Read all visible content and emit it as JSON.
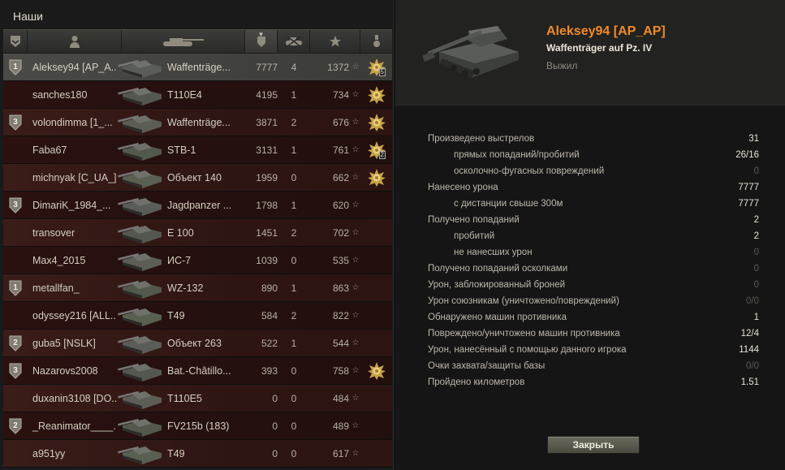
{
  "team_title": "Наши",
  "icons": {
    "header": [
      "rank-icon",
      "player-icon",
      "vehicle-icon",
      "damage-icon",
      "kills-icon",
      "xp-icon",
      "medal-icon"
    ]
  },
  "players": [
    {
      "badge": "1",
      "name": "Aleksey94 [AP_A...",
      "vehicle": "Waffenträge...",
      "damage": "7777",
      "kills": "4",
      "xp": "1372",
      "medal": "ace",
      "medal_count": "5",
      "selected": true
    },
    {
      "badge": "",
      "name": "sanches180",
      "vehicle": "T110E4",
      "damage": "4195",
      "kills": "1",
      "xp": "734",
      "medal": "ace",
      "medal_count": ""
    },
    {
      "badge": "3",
      "name": "volondimma [1_...",
      "vehicle": "Waffenträge...",
      "damage": "3871",
      "kills": "2",
      "xp": "676",
      "medal": "ace",
      "medal_count": ""
    },
    {
      "badge": "",
      "name": "Faba67",
      "vehicle": "STB-1",
      "damage": "3131",
      "kills": "1",
      "xp": "761",
      "medal": "ace",
      "medal_count": "2"
    },
    {
      "badge": "",
      "name": "michnyak [C_UA_]",
      "vehicle": "Объект 140",
      "damage": "1959",
      "kills": "0",
      "xp": "662",
      "medal": "ace",
      "medal_count": ""
    },
    {
      "badge": "3",
      "name": "DimariK_1984_...",
      "vehicle": "Jagdpanzer ...",
      "damage": "1798",
      "kills": "1",
      "xp": "620",
      "medal": "",
      "medal_count": ""
    },
    {
      "badge": "",
      "name": "transover",
      "vehicle": "E 100",
      "damage": "1451",
      "kills": "2",
      "xp": "702",
      "medal": "",
      "medal_count": ""
    },
    {
      "badge": "",
      "name": "Max4_2015",
      "vehicle": "ИС-7",
      "damage": "1039",
      "kills": "0",
      "xp": "535",
      "medal": "",
      "medal_count": ""
    },
    {
      "badge": "1",
      "name": "metallfan_",
      "vehicle": "WZ-132",
      "damage": "890",
      "kills": "1",
      "xp": "863",
      "medal": "",
      "medal_count": ""
    },
    {
      "badge": "",
      "name": "odyssey216 [ALL...",
      "vehicle": "T49",
      "damage": "584",
      "kills": "2",
      "xp": "822",
      "medal": "",
      "medal_count": ""
    },
    {
      "badge": "2",
      "name": "guba5 [NSLK]",
      "vehicle": "Объект 263",
      "damage": "522",
      "kills": "1",
      "xp": "544",
      "medal": "",
      "medal_count": ""
    },
    {
      "badge": "3",
      "name": "Nazarovs2008",
      "vehicle": "Bat.-Châtillo...",
      "damage": "393",
      "kills": "0",
      "xp": "758",
      "medal": "ace",
      "medal_count": ""
    },
    {
      "badge": "",
      "name": "duxanin3108 [DO...",
      "vehicle": "T110E5",
      "damage": "0",
      "kills": "0",
      "xp": "484",
      "medal": "",
      "medal_count": ""
    },
    {
      "badge": "2",
      "name": "_Reanimator____...",
      "vehicle": "FV215b (183)",
      "damage": "0",
      "kills": "0",
      "xp": "489",
      "medal": "",
      "medal_count": ""
    },
    {
      "badge": "",
      "name": "a951yy",
      "vehicle": "T49",
      "damage": "0",
      "kills": "0",
      "xp": "617",
      "medal": "",
      "medal_count": ""
    }
  ],
  "detail": {
    "player": "Aleksey94 [AP_AP]",
    "vehicle": "Waffenträger auf Pz. IV",
    "status": "Выжил",
    "stats": [
      {
        "label": "Произведено выстрелов",
        "value": "31",
        "indent": false,
        "zero": false
      },
      {
        "label": "прямых попаданий/пробитий",
        "value": "26/16",
        "indent": true,
        "zero": false
      },
      {
        "label": "осколочно-фугасных повреждений",
        "value": "0",
        "indent": true,
        "zero": true
      },
      {
        "label": "Нанесено урона",
        "value": "7777",
        "indent": false,
        "zero": false
      },
      {
        "label": "с дистанции свыше 300м",
        "value": "7777",
        "indent": true,
        "zero": false
      },
      {
        "label": "Получено попаданий",
        "value": "2",
        "indent": false,
        "zero": false
      },
      {
        "label": "пробитий",
        "value": "2",
        "indent": true,
        "zero": false
      },
      {
        "label": "не нанесших урон",
        "value": "0",
        "indent": true,
        "zero": true
      },
      {
        "label": "Получено попаданий осколками",
        "value": "0",
        "indent": false,
        "zero": true
      },
      {
        "label": "Урон, заблокированный броней",
        "value": "0",
        "indent": false,
        "zero": true
      },
      {
        "label": "Урон союзникам (уничтожено/повреждений)",
        "value": "0/0",
        "indent": false,
        "zero": true
      },
      {
        "label": "Обнаружено машин противника",
        "value": "1",
        "indent": false,
        "zero": false
      },
      {
        "label": "Повреждено/уничтожено машин противника",
        "value": "12/4",
        "indent": false,
        "zero": false
      },
      {
        "label": "Урон, нанесённый с помощью данного игрока",
        "value": "1144",
        "indent": false,
        "zero": false
      },
      {
        "label": "Очки захвата/защиты базы",
        "value": "0/0",
        "indent": false,
        "zero": true
      },
      {
        "label": "Пройдено километров",
        "value": "1.51",
        "indent": false,
        "zero": false
      }
    ],
    "close_label": "Закрыть"
  },
  "colors": {
    "accent_name": "#f08a2b",
    "row_red": "#2e1513",
    "selected_row": "#3b3b38"
  }
}
